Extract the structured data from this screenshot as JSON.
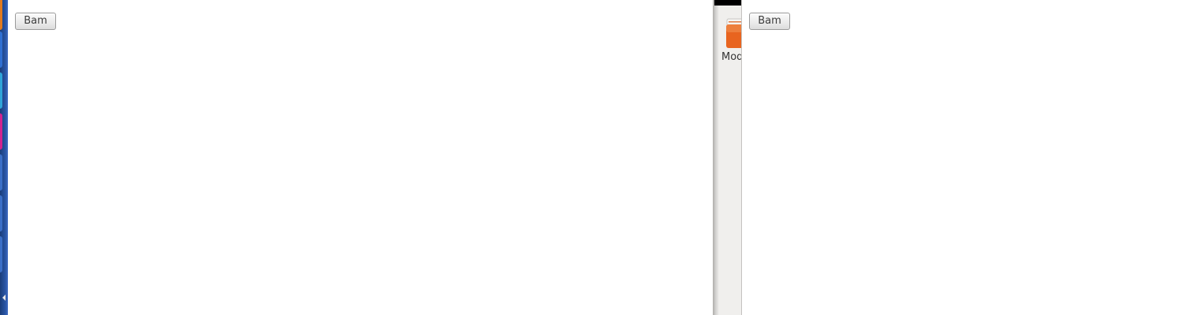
{
  "launcher": {
    "tile_colors": [
      "#e07a1f",
      "#2f6fd1",
      "#2fa4d8",
      "#d1238f",
      "#3b6fc7",
      "#3b6fc7",
      "#3b6fc7"
    ]
  },
  "left_window": {
    "button_label": "Bam"
  },
  "file_panel": {
    "folder_label": "Mod",
    "folder_color": "#e8641f"
  },
  "right_window": {
    "button_label": "Bam"
  }
}
